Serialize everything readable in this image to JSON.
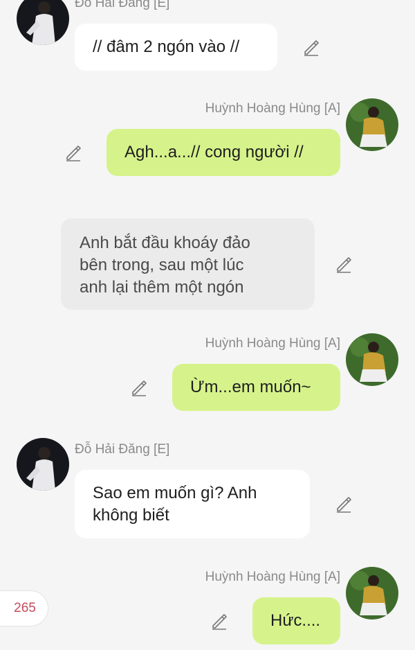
{
  "colors": {
    "background": "#f5f5f5",
    "bubble_white": "#ffffff",
    "bubble_green": "#d6f38b",
    "bubble_gray": "#ebebeb",
    "name_text": "#8a8a8a",
    "counter_text": "#c54a5a"
  },
  "participants": {
    "e": {
      "name": "Đỗ Hải Đăng [E]"
    },
    "a": {
      "name": "Huỳnh Hoàng Hùng [A]"
    }
  },
  "messages": [
    {
      "speaker": "e",
      "name": "Đỗ Hải Đăng [E]",
      "text": "// đâm 2 ngón vào //",
      "icon": "edit-pencil-icon"
    },
    {
      "speaker": "a",
      "name": "Huỳnh Hoàng Hùng [A]",
      "text": "Agh...a...// cong người //",
      "icon": "edit-pencil-icon"
    },
    {
      "speaker": "narration",
      "lines": [
        "Anh bắt đầu khoáy đảo",
        "bên trong, sau một lúc",
        "anh lại thêm một ngón"
      ],
      "icon": "edit-pencil-icon"
    },
    {
      "speaker": "a",
      "name": "Huỳnh Hoàng Hùng [A]",
      "text": "Ừm...em muốn~",
      "icon": "edit-pencil-icon"
    },
    {
      "speaker": "e",
      "name": "Đỗ Hải Đăng [E]",
      "lines": [
        "Sao em muốn gì? Anh",
        "không biết"
      ],
      "icon": "edit-pencil-icon"
    },
    {
      "speaker": "a",
      "name": "Huỳnh Hoàng Hùng [A]",
      "text": "Hức....",
      "icon": "edit-pencil-icon"
    }
  ],
  "counter": {
    "value": "265"
  }
}
